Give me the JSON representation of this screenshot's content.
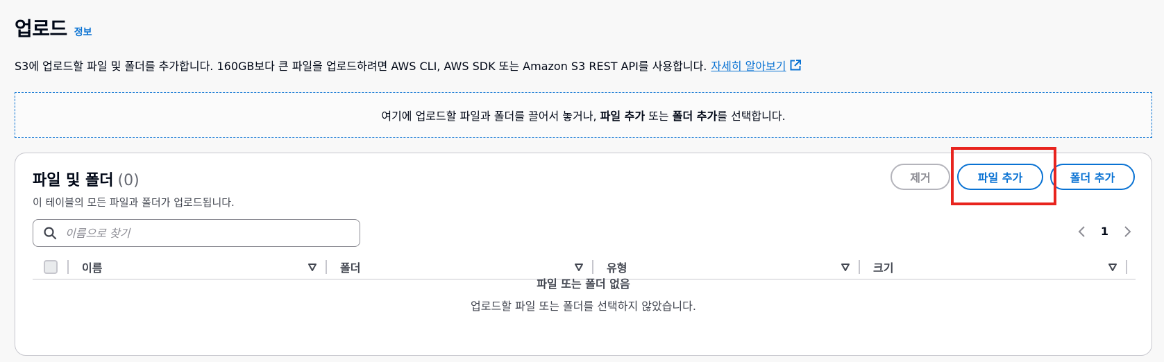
{
  "header": {
    "title": "업로드",
    "info_link": "정보"
  },
  "description": {
    "text": "S3에 업로드할 파일 및 폴더를 추가합니다. 160GB보다 큰 파일을 업로드하려면 AWS CLI, AWS SDK 또는 Amazon S3 REST API를 사용합니다.",
    "learn_more": "자세히 알아보기"
  },
  "dropzone": {
    "prefix": "여기에 업로드할 파일과 폴더를 끌어서 놓거나,",
    "add_files": "파일 추가",
    "or": "또는",
    "add_folder": "폴더 추가",
    "suffix": "를 선택합니다."
  },
  "panel": {
    "title": "파일 및 폴더",
    "count": "(0)",
    "subtitle": "이 테이블의 모든 파일과 폴더가 업로드됩니다.",
    "buttons": {
      "remove": "제거",
      "add_files": "파일 추가",
      "add_folder": "폴더 추가"
    },
    "search": {
      "placeholder": "이름으로 찾기"
    },
    "pagination": {
      "current_page": "1"
    },
    "columns": [
      "이름",
      "폴더",
      "유형",
      "크기"
    ],
    "empty": {
      "title": "파일 또는 폴더 없음",
      "description": "업로드할 파일 또는 폴더를 선택하지 않았습니다."
    }
  },
  "colors": {
    "accent": "#0972d3",
    "highlight": "#e8241e",
    "text": "#000716",
    "muted": "#424650"
  }
}
